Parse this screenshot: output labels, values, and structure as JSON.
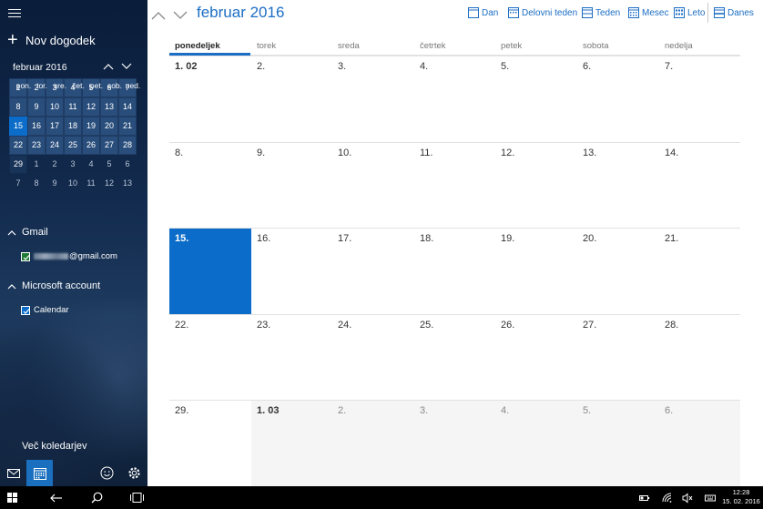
{
  "sidebar": {
    "new_event_label": "Nov dogodek",
    "mini_calendar": {
      "title": "februar 2016",
      "weekdays": [
        "pon.",
        "tor.",
        "sre.",
        "čet.",
        "pet.",
        "sob.",
        "ned."
      ],
      "weeks": [
        [
          "1",
          "2",
          "3",
          "4",
          "5",
          "6",
          "7"
        ],
        [
          "8",
          "9",
          "10",
          "11",
          "12",
          "13",
          "14"
        ],
        [
          "15",
          "16",
          "17",
          "18",
          "19",
          "20",
          "21"
        ],
        [
          "22",
          "23",
          "24",
          "25",
          "26",
          "27",
          "28"
        ],
        [
          "29",
          "1",
          "2",
          "3",
          "4",
          "5",
          "6"
        ],
        [
          "7",
          "8",
          "9",
          "10",
          "11",
          "12",
          "13"
        ]
      ],
      "today": "15"
    },
    "groups": [
      {
        "name": "Gmail",
        "calendars": [
          {
            "label": "@gmail.com",
            "color": "#1e7a34"
          }
        ]
      },
      {
        "name": "Microsoft account",
        "calendars": [
          {
            "label": "Calendar",
            "color": "#0b6cc9"
          }
        ]
      }
    ],
    "more_calendars_label": "Več koledarjev"
  },
  "header": {
    "month_title": "februar 2016",
    "views": {
      "day": "Dan",
      "work_week": "Delovni teden",
      "week": "Teden",
      "month": "Mesec",
      "year": "Leto",
      "today": "Danes"
    }
  },
  "month_view": {
    "weekdays": [
      "ponedeljek",
      "torek",
      "sreda",
      "četrtek",
      "petek",
      "sobota",
      "nedelja"
    ],
    "weeks": [
      [
        "1. 02",
        "2.",
        "3.",
        "4.",
        "5.",
        "6.",
        "7."
      ],
      [
        "8.",
        "9.",
        "10.",
        "11.",
        "12.",
        "13.",
        "14."
      ],
      [
        "15.",
        "16.",
        "17.",
        "18.",
        "19.",
        "20.",
        "21."
      ],
      [
        "22.",
        "23.",
        "24.",
        "25.",
        "26.",
        "27.",
        "28."
      ],
      [
        "29.",
        "1. 03",
        "2.",
        "3.",
        "4.",
        "5.",
        "6."
      ]
    ],
    "today_label": "15."
  },
  "taskbar": {
    "time": "12:28",
    "date": "15. 02. 2016"
  },
  "colors": {
    "accent": "#0b6cc9",
    "link": "#1c6ec4"
  }
}
